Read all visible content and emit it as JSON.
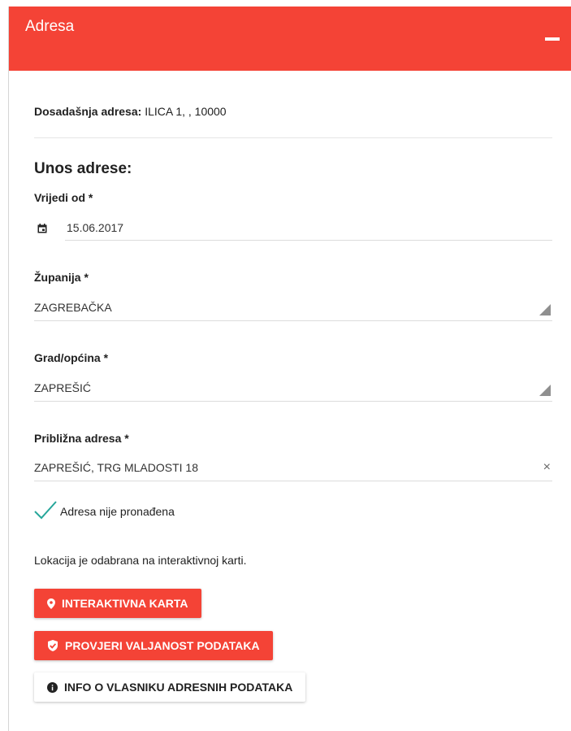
{
  "panel": {
    "title": "Adresa"
  },
  "previous_address": {
    "label": "Dosadašnja adresa:",
    "value": "ILICA 1, , 10000"
  },
  "form": {
    "section_title": "Unos adrese:",
    "valid_from": {
      "label": "Vrijedi od *",
      "value": "15.06.2017"
    },
    "county": {
      "label": "Županija *",
      "value": "ZAGREBAČKA"
    },
    "city": {
      "label": "Grad/općina *",
      "value": "ZAPREŠIĆ"
    },
    "approx_address": {
      "label": "Približna adresa *",
      "value": "ZAPREŠIĆ, TRG MLADOSTI 18",
      "clear": "×"
    }
  },
  "status": {
    "text": "Adresa nije pronađena"
  },
  "info_text": "Lokacija je odabrana na interaktivnoj karti.",
  "buttons": {
    "map": "INTERAKTIVNA KARTA",
    "validate": "PROVJERI VALJANOST PODATAKA",
    "owner_info": "INFO O VLASNIKU ADRESNIH PODATAKA"
  },
  "colors": {
    "accent": "#f44336",
    "check": "#26a69a"
  }
}
